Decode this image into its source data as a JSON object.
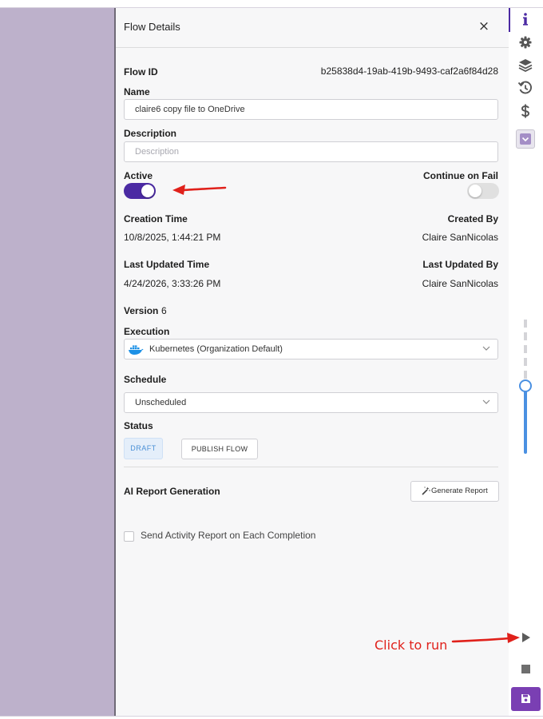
{
  "panel": {
    "title": "Flow Details",
    "close_symbol": "×",
    "flow_id_label": "Flow ID",
    "flow_id": "b25838d4-19ab-419b-9493-caf2a6f84d28",
    "name_label": "Name",
    "name_value": "claire6 copy file to OneDrive",
    "description_label": "Description",
    "description_placeholder": "Description",
    "active_label": "Active",
    "active": true,
    "continue_on_fail_label": "Continue on Fail",
    "continue_on_fail": false,
    "creation_time_label": "Creation Time",
    "creation_time": "10/8/2025, 1:44:21 PM",
    "created_by_label": "Created By",
    "created_by": "Claire SanNicolas",
    "last_updated_time_label": "Last Updated Time",
    "last_updated_time": "4/24/2026, 3:33:26 PM",
    "last_updated_by_label": "Last Updated By",
    "last_updated_by": "Claire SanNicolas",
    "version_label": "Version",
    "version": "6",
    "execution_label": "Execution",
    "execution_value": "Kubernetes (Organization Default)",
    "execution_icon": "docker-icon",
    "schedule_label": "Schedule",
    "schedule_value": "Unscheduled",
    "status_label": "Status",
    "status_badge": "DRAFT",
    "publish_label": "PUBLISH FLOW",
    "ai_report_label": "AI Report Generation",
    "generate_report_label": "Generate Report",
    "send_report_label": "Send Activity Report on Each Completion",
    "send_report_checked": false
  },
  "rail": {
    "icons": [
      "info-icon",
      "gear-icon",
      "layers-icon",
      "history-icon",
      "dollar-icon",
      "collapse-icon",
      "run-icon",
      "stop-icon",
      "save-icon"
    ],
    "zoom_level": 0.5
  },
  "annotations": {
    "run_hint": "Click to run"
  },
  "colors": {
    "accent": "#4b2aa3",
    "save_button": "#7a3fb3",
    "backdrop": "#bdb1cb",
    "annotation_red": "#e0211b",
    "zoom_blue": "#4a90e2"
  }
}
